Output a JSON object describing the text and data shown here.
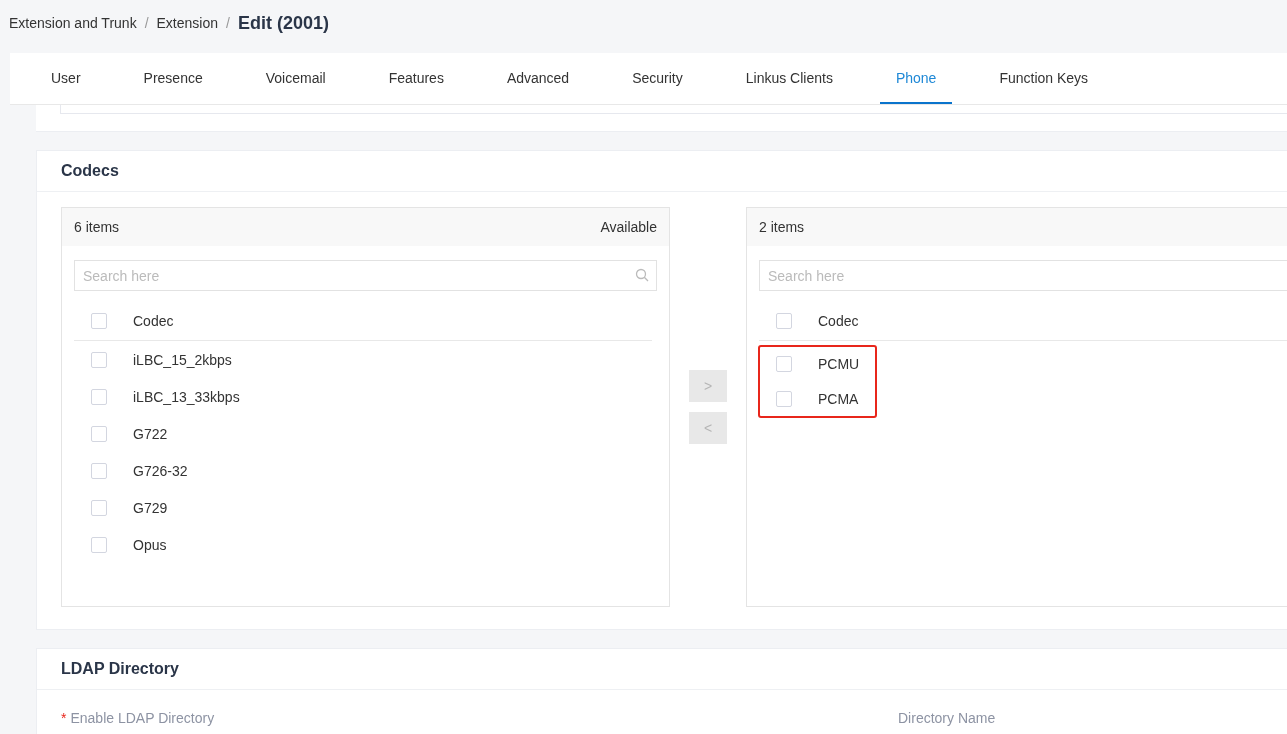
{
  "breadcrumb": {
    "items": [
      "Extension and Trunk",
      "Extension"
    ],
    "separator": "/",
    "title": "Edit (2001)"
  },
  "tabs": [
    {
      "label": "User",
      "selected": false
    },
    {
      "label": "Presence",
      "selected": false
    },
    {
      "label": "Voicemail",
      "selected": false
    },
    {
      "label": "Features",
      "selected": false
    },
    {
      "label": "Advanced",
      "selected": false
    },
    {
      "label": "Security",
      "selected": false
    },
    {
      "label": "Linkus Clients",
      "selected": false
    },
    {
      "label": "Phone",
      "selected": true
    },
    {
      "label": "Function Keys",
      "selected": false
    }
  ],
  "codecs": {
    "title": "Codecs",
    "available": {
      "count": "6 items",
      "heading": "Available",
      "search_placeholder": "Search here",
      "column": "Codec",
      "header_checked": false,
      "items": [
        {
          "label": "iLBC_15_2kbps",
          "checked": false
        },
        {
          "label": "iLBC_13_33kbps",
          "checked": false
        },
        {
          "label": "G722",
          "checked": false
        },
        {
          "label": "G726-32",
          "checked": false
        },
        {
          "label": "G729",
          "checked": false
        },
        {
          "label": "Opus",
          "checked": false
        }
      ]
    },
    "transfer_buttons": [
      {
        "label": ">",
        "disabled": true
      },
      {
        "label": "<",
        "disabled": true
      }
    ],
    "selected": {
      "count": "2 items",
      "search_placeholder": "Search here",
      "column": "Codec",
      "header_checked": false,
      "highlighted": true,
      "items": [
        {
          "label": "PCMU",
          "checked": false
        },
        {
          "label": "PCMA",
          "checked": false
        }
      ]
    }
  },
  "ldap": {
    "title": "LDAP Directory",
    "fields": [
      {
        "label": "Enable LDAP Directory",
        "required_mark": "*"
      },
      {
        "label": "Directory Name"
      }
    ]
  }
}
